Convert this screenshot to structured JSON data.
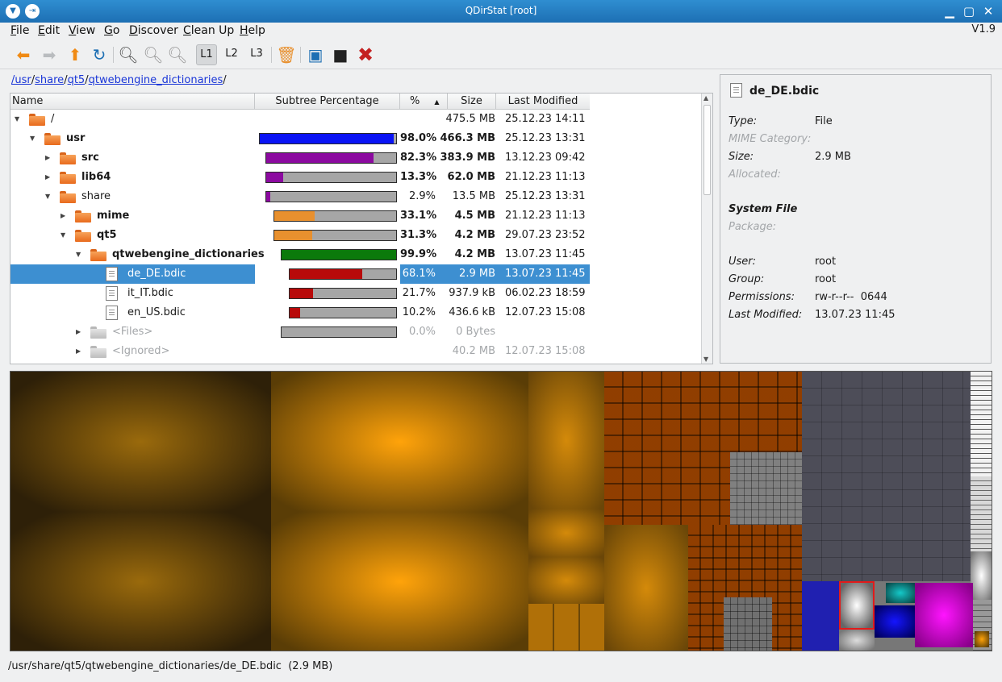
{
  "window": {
    "title": "QDirStat [root]",
    "version": "V1.9"
  },
  "menu": [
    {
      "label": "File",
      "mnemonic": "F",
      "rest": "ile"
    },
    {
      "label": "Edit",
      "mnemonic": "E",
      "rest": "dit"
    },
    {
      "label": "View",
      "mnemonic": "V",
      "rest": "iew"
    },
    {
      "label": "Go",
      "mnemonic": "G",
      "rest": "o"
    },
    {
      "label": "Discover",
      "mnemonic": "D",
      "rest": "iscover"
    },
    {
      "label": "Clean Up",
      "mnemonic": "C",
      "rest": "lean Up"
    },
    {
      "label": "Help",
      "mnemonic": "H",
      "rest": "elp"
    }
  ],
  "toolbar": {
    "level1": "L1",
    "level2": "L2",
    "level3": "L3"
  },
  "breadcrumb": [
    "/usr",
    "share",
    "qt5",
    "qtwebengine_dictionaries"
  ],
  "columns": {
    "name": "Name",
    "subtree": "Subtree Percentage",
    "pct": "%",
    "size": "Size",
    "modified": "Last Modified"
  },
  "tree": [
    {
      "name": "/",
      "pct": "",
      "size": "475.5 MB",
      "modified": "25.12.23 14:11",
      "bold": false,
      "dim": false
    },
    {
      "name": "usr",
      "pct": "98.0%",
      "size": "466.3 MB",
      "modified": "25.12.23 13:31",
      "bold": true,
      "dim": false,
      "fill": 0.98,
      "color": "#0a14f5"
    },
    {
      "name": "src",
      "pct": "82.3%",
      "size": "383.9 MB",
      "modified": "13.12.23 09:42",
      "bold": true,
      "dim": false,
      "fill": 0.823,
      "color": "#8c0aa0"
    },
    {
      "name": "lib64",
      "pct": "13.3%",
      "size": "62.0 MB",
      "modified": "21.12.23 11:13",
      "bold": true,
      "dim": false,
      "fill": 0.133,
      "color": "#8c0aa0"
    },
    {
      "name": "share",
      "pct": "2.9%",
      "size": "13.5 MB",
      "modified": "25.12.23 13:31",
      "bold": false,
      "dim": false,
      "fill": 0.029,
      "color": "#8c0aa0"
    },
    {
      "name": "mime",
      "pct": "33.1%",
      "size": "4.5 MB",
      "modified": "21.12.23 11:13",
      "bold": true,
      "dim": false,
      "fill": 0.331,
      "color": "#e8902e"
    },
    {
      "name": "qt5",
      "pct": "31.3%",
      "size": "4.2 MB",
      "modified": "29.07.23 23:52",
      "bold": true,
      "dim": false,
      "fill": 0.313,
      "color": "#e8902e"
    },
    {
      "name": "qtwebengine_dictionaries",
      "pct": "99.9%",
      "size": "4.2 MB",
      "modified": "13.07.23 11:45",
      "bold": true,
      "dim": false,
      "fill": 0.999,
      "color": "#0b7a0b"
    },
    {
      "name": "de_DE.bdic",
      "pct": "68.1%",
      "size": "2.9 MB",
      "modified": "13.07.23 11:45",
      "bold": false,
      "dim": false,
      "fill": 0.681,
      "color": "#b80a0a",
      "selected": true
    },
    {
      "name": "it_IT.bdic",
      "pct": "21.7%",
      "size": "937.9 kB",
      "modified": "06.02.23 18:59",
      "bold": false,
      "dim": false,
      "fill": 0.217,
      "color": "#b80a0a"
    },
    {
      "name": "en_US.bdic",
      "pct": "10.2%",
      "size": "436.6 kB",
      "modified": "12.07.23 15:08",
      "bold": false,
      "dim": false,
      "fill": 0.102,
      "color": "#b80a0a"
    },
    {
      "name": "<Files>",
      "pct": "0.0%",
      "size": "0 Bytes",
      "modified": "",
      "bold": false,
      "dim": true,
      "fill": 0.0,
      "color": "#0b7a0b"
    },
    {
      "name": "<Ignored>",
      "pct": "",
      "size": "40.2 MB",
      "modified": "12.07.23 15:08",
      "bold": false,
      "dim": true
    }
  ],
  "details": {
    "filename": "de_DE.bdic",
    "type_label": "Type:",
    "type_value": "File",
    "mime_label": "MIME Category:",
    "size_label": "Size:",
    "size_value": "2.9 MB",
    "allocated_label": "Allocated:",
    "system_file": "System File",
    "package_label": "Package:",
    "user_label": "User:",
    "user_value": "root",
    "group_label": "Group:",
    "group_value": "root",
    "perm_label": "Permissions:",
    "perm_value": "rw-r--r--  0644",
    "modified_label": "Last Modified:",
    "modified_value": "13.07.23 11:45"
  },
  "status": "/usr/share/qt5/qtwebengine_dictionaries/de_DE.bdic  (2.9 MB)"
}
